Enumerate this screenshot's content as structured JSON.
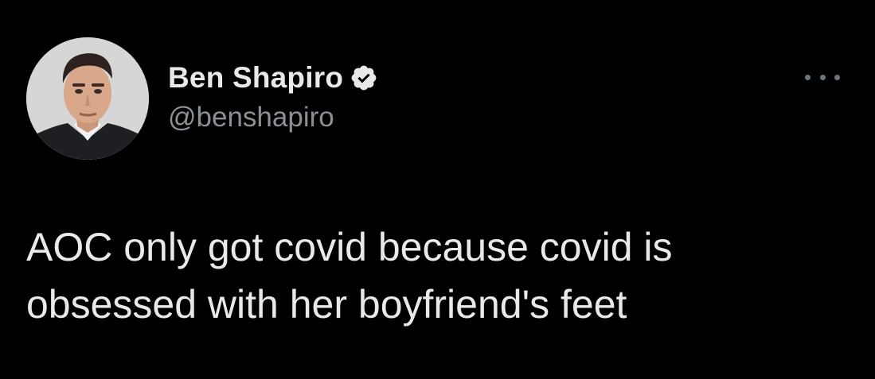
{
  "tweet": {
    "author": {
      "display_name": "Ben Shapiro",
      "handle": "@benshapiro",
      "verified": true
    },
    "text": "AOC only got covid because covid is\nobsessed with her boyfriend's feet",
    "more_icon": "more-horizontal-icon"
  },
  "colors": {
    "background": "#000000",
    "primary_text": "#e7e9ea",
    "secondary_text": "#8b9096",
    "verified_badge": "#e7e9ea"
  }
}
